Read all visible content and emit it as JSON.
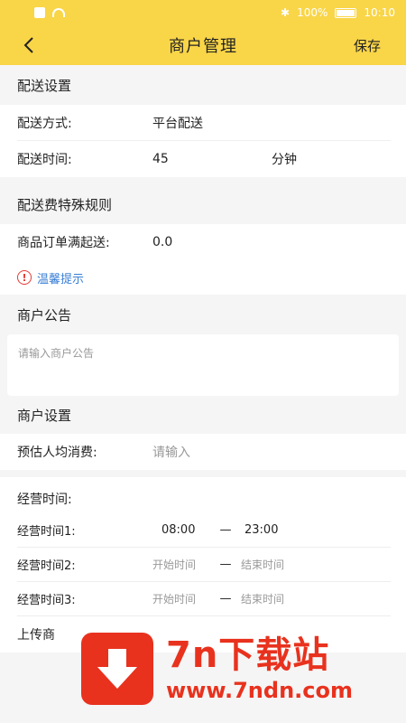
{
  "status_bar": {
    "battery": "100%",
    "time": "10:10"
  },
  "nav": {
    "title": "商户管理",
    "save": "保存"
  },
  "delivery": {
    "header": "配送设置",
    "method_label": "配送方式:",
    "method_value": "平台配送",
    "time_label": "配送时间:",
    "time_value": "45",
    "time_unit": "分钟"
  },
  "fee_rules": {
    "header": "配送费特殊规则",
    "min_order_label": "商品订单满起送:",
    "min_order_value": "0.0",
    "tip": "温馨提示"
  },
  "notice": {
    "header": "商户公告",
    "placeholder": "请输入商户公告"
  },
  "merchant": {
    "header": "商户设置",
    "avg_label": "预估人均消费:",
    "avg_placeholder": "请输入"
  },
  "hours": {
    "title": "经营时间:",
    "rows": [
      {
        "label": "经营时间1:",
        "start": "08:00",
        "dash": "—",
        "end": "23:00"
      },
      {
        "label": "经营时间2:",
        "start": "开始时间",
        "dash": "—",
        "end": "结束时间"
      },
      {
        "label": "经营时间3:",
        "start": "开始时间",
        "dash": "—",
        "end": "结束时间"
      }
    ],
    "upload_label": "上传商"
  },
  "watermark": {
    "brand": "7n下载站",
    "url": "www.7ndn.com"
  },
  "colors": {
    "accent": "#f9d548",
    "link": "#3a7fd5",
    "warning": "#e53935",
    "watermark": "#e8321e"
  }
}
